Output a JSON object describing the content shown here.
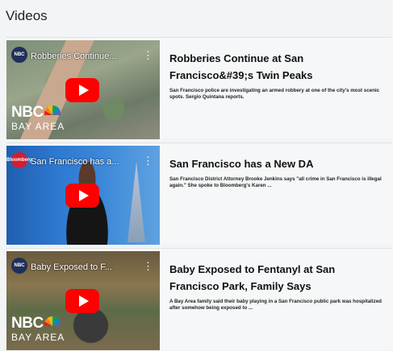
{
  "section_title": "Videos",
  "videos": [
    {
      "overlay_title": "Robberies Continue...",
      "headline": "Robberies Continue at San Francisco&#39;s Twin Peaks",
      "description": "San Francisco police are investigating an armed robbery at one of the city's most scenic spots. Sergio Quintana reports.",
      "channel": "NBC",
      "brand": "NBC",
      "brand_sub": "BAY AREA"
    },
    {
      "overlay_title": "San Francisco has a...",
      "headline": "San Francisco has a New DA",
      "description": "San Francisco District Attorney Brooke Jenkins says \"all crime in San Francisco is illegal again.\" She spoke to Bloomberg's Karen ...",
      "channel": "Bloomberg"
    },
    {
      "overlay_title": "Baby Exposed to F...",
      "headline": "Baby Exposed to Fentanyl at San Francisco Park, Family Says",
      "description": "A Bay Area family said their baby playing in a San Francisco public park was hospitalized after somehow being exposed to ...",
      "channel": "NBC",
      "brand": "NBC",
      "brand_sub": "BAY AREA"
    }
  ],
  "colors": {
    "play_button": "#ff0000",
    "background": "#f3f4f5"
  }
}
